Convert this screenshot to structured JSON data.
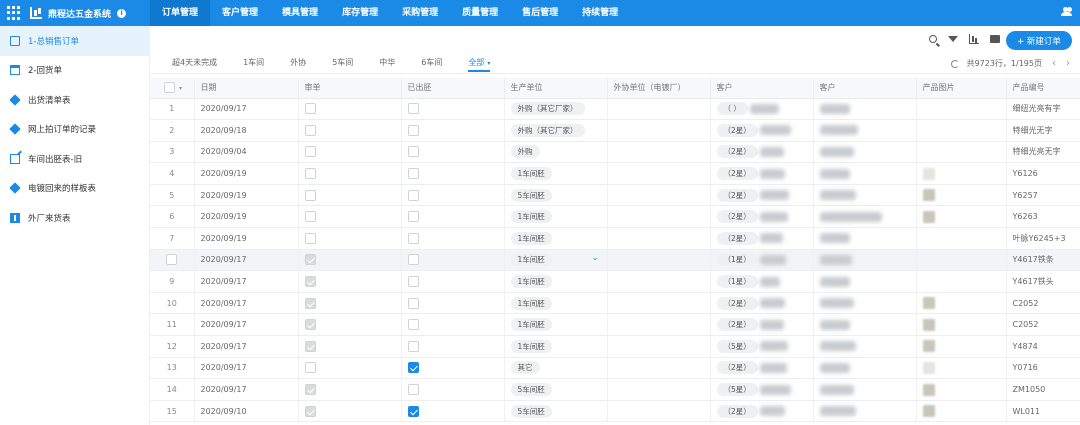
{
  "app": {
    "title": "鼎程达五金系统",
    "info_glyph": "i",
    "nav": [
      "订单管理",
      "客户管理",
      "模具管理",
      "库存管理",
      "采购管理",
      "质量管理",
      "售后管理",
      "持续管理"
    ],
    "active_nav": 0,
    "accent": "#1a8ae6"
  },
  "sidebar": {
    "items": [
      {
        "label": "1-总销售订单",
        "icon": "doc-icon"
      },
      {
        "label": "2-回货单",
        "icon": "calendar-icon"
      },
      {
        "label": "出货清单表",
        "icon": "cube-icon"
      },
      {
        "label": "网上拍订单的记录",
        "icon": "cube-icon"
      },
      {
        "label": "车间出胚表-旧",
        "icon": "edit-icon"
      },
      {
        "label": "电镀回来的样板表",
        "icon": "cube-icon"
      },
      {
        "label": "外厂来货表",
        "icon": "board-icon"
      }
    ],
    "active": 0
  },
  "toolbar": {
    "new_button": "+ 新建订单"
  },
  "tabs": {
    "items": [
      "超4天未完成",
      "1车间",
      "外协",
      "5车间",
      "中华",
      "6车间",
      "全部"
    ],
    "active": 6,
    "caret": "▾"
  },
  "pager": {
    "summary": "共9723行，1/195页",
    "prev": "‹",
    "next": "›"
  },
  "table": {
    "head_caret": "▾",
    "columns": [
      "日期",
      "审单",
      "已出胚",
      "生产单位",
      "外协单位（电镀厂）",
      "客户",
      "客户",
      "产品图片",
      "产品编号"
    ],
    "dropdown_glyph": "⌄",
    "rows": [
      {
        "no": "1",
        "date": "2020/09/17",
        "audit": "empty",
        "out": "empty",
        "unit": "外购（其它厂家）",
        "client": "（ ）",
        "img": "",
        "code": "细纽光亮有字"
      },
      {
        "no": "2",
        "date": "2020/09/18",
        "audit": "empty",
        "out": "empty",
        "unit": "外购（其它厂家）",
        "client": "（2星）",
        "img": "",
        "code": "特细光无字"
      },
      {
        "no": "3",
        "date": "2020/09/04",
        "audit": "empty",
        "out": "empty",
        "unit": "外购",
        "client": "（2星）",
        "img": "",
        "code": "特细光亮无字"
      },
      {
        "no": "4",
        "date": "2020/09/19",
        "audit": "empty",
        "out": "empty",
        "unit": "1车间胚",
        "client": "（2星）",
        "img": "light",
        "code": "Y6126"
      },
      {
        "no": "5",
        "date": "2020/09/19",
        "audit": "empty",
        "out": "empty",
        "unit": "5车间胚",
        "client": "（2星）",
        "img": "dark",
        "code": "Y6257"
      },
      {
        "no": "6",
        "date": "2020/09/19",
        "audit": "empty",
        "out": "empty",
        "unit": "1车间胚",
        "client": "（2星）",
        "img": "dark",
        "code": "Y6263"
      },
      {
        "no": "7",
        "date": "2020/09/19",
        "audit": "empty",
        "out": "empty",
        "unit": "1车间胚",
        "client": "（2星）",
        "img": "",
        "code": "叶脉Y6245+3"
      },
      {
        "no": "",
        "date": "2020/09/17",
        "audit": "gray",
        "out": "empty",
        "unit": "1车间胚",
        "client": "（1星）",
        "img": "",
        "code": "Y4617铁条",
        "highlight": true,
        "dropdown": true
      },
      {
        "no": "9",
        "date": "2020/09/17",
        "audit": "gray",
        "out": "empty",
        "unit": "1车间胚",
        "client": "（1星）",
        "img": "",
        "code": "Y4617铁头"
      },
      {
        "no": "10",
        "date": "2020/09/17",
        "audit": "gray",
        "out": "empty",
        "unit": "1车间胚",
        "client": "（2星）",
        "img": "dark",
        "code": "C2052"
      },
      {
        "no": "11",
        "date": "2020/09/17",
        "audit": "gray",
        "out": "empty",
        "unit": "1车间胚",
        "client": "（2星）",
        "img": "dark",
        "code": "C2052"
      },
      {
        "no": "12",
        "date": "2020/09/17",
        "audit": "gray",
        "out": "empty",
        "unit": "1车间胚",
        "client": "（5星）",
        "img": "dark",
        "code": "Y4874"
      },
      {
        "no": "13",
        "date": "2020/09/17",
        "audit": "empty",
        "out": "blue",
        "unit": "其它",
        "client": "（2星）",
        "img": "light",
        "code": "Y0716"
      },
      {
        "no": "14",
        "date": "2020/09/17",
        "audit": "gray",
        "out": "empty",
        "unit": "5车间胚",
        "client": "（5星）",
        "img": "dark",
        "code": "ZM1050"
      },
      {
        "no": "15",
        "date": "2020/09/10",
        "audit": "gray",
        "out": "blue",
        "unit": "5车间胚",
        "client": "（2星）",
        "img": "dark",
        "code": "WL011"
      }
    ]
  }
}
